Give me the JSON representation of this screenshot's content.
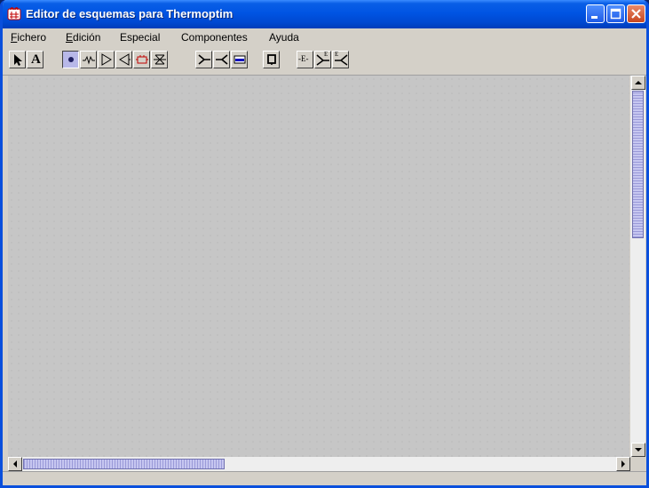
{
  "window": {
    "title": "Editor de esquemas para Thermoptim",
    "titlebar_color": "#0054e3"
  },
  "menu": [
    {
      "label": "Fichero",
      "mnemonic": "F",
      "rest": "ichero"
    },
    {
      "label": "Edición",
      "mnemonic": "E",
      "rest": "dición"
    },
    {
      "label": "Especial",
      "mnemonic": "",
      "rest": "Especial"
    },
    {
      "label": "Componentes",
      "mnemonic": "",
      "rest": "Componentes"
    },
    {
      "label": "Ayuda",
      "mnemonic": "",
      "rest": "Ayuda"
    }
  ],
  "toolbar": {
    "tools": [
      {
        "name": "select-tool",
        "icon": "arrow-cursor-icon"
      },
      {
        "name": "text-tool",
        "icon": "text-a-icon",
        "glyph": "A"
      },
      {
        "name": "point-tool",
        "icon": "point-icon",
        "selected": true
      },
      {
        "name": "exchange-tool",
        "icon": "zigzag-icon"
      },
      {
        "name": "compressor-tool",
        "icon": "triangle-right-icon"
      },
      {
        "name": "turbine-tool",
        "icon": "triangle-left-icon"
      },
      {
        "name": "combustion-tool",
        "icon": "heater-icon"
      },
      {
        "name": "throttle-tool",
        "icon": "valve-icon"
      },
      {
        "name": "mixer-tool",
        "icon": "mixer-icon"
      },
      {
        "name": "divider-tool",
        "icon": "divider-icon"
      },
      {
        "name": "heat-exchanger-tool",
        "icon": "exchanger-icon"
      },
      {
        "name": "process-tool",
        "icon": "box-icon"
      },
      {
        "name": "external-process-tool",
        "icon": "external-icon",
        "glyph": "-E-"
      },
      {
        "name": "external-mixer-tool",
        "icon": "external-mixer-icon",
        "glyph": "E"
      },
      {
        "name": "external-divider-tool",
        "icon": "external-divider-icon",
        "glyph": "E"
      }
    ]
  },
  "scrollbars": {
    "vertical_thumb_fraction": 0.42,
    "horizontal_thumb_fraction": 0.34
  }
}
